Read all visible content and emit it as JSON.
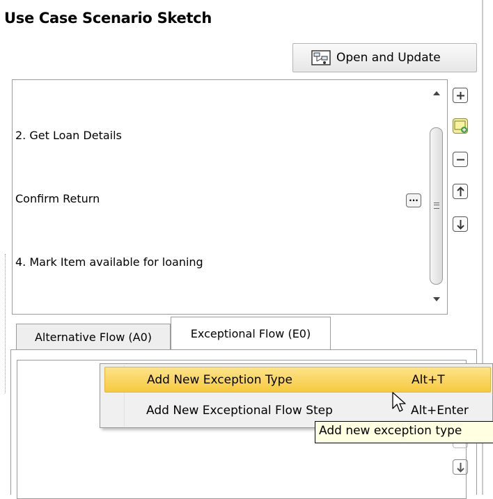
{
  "panel": {
    "title": "Use Case Scenario Sketch",
    "open_update_label": "Open and Update"
  },
  "steps": {
    "items": [
      {
        "label": "2. Get Loan Details"
      },
      {
        "label": "Confirm Return"
      },
      {
        "label": "4. Mark Item available for loaning"
      }
    ],
    "more_label": "..."
  },
  "side_toolbar": {
    "icons": [
      "add-icon",
      "add-note-icon",
      "remove-icon",
      "move-up-icon",
      "move-down-icon"
    ]
  },
  "tabs": [
    {
      "label": "Alternative Flow (A0)",
      "selected": false
    },
    {
      "label": "Exceptional Flow (E0)",
      "selected": true
    }
  ],
  "context_menu": {
    "items": [
      {
        "label": "Add New Exception Type",
        "shortcut": "Alt+T",
        "highlighted": true
      },
      {
        "label": "Add New Exceptional Flow Step",
        "shortcut": "Alt+Enter",
        "highlighted": false
      }
    ]
  },
  "tooltip": {
    "text": "Add new exception type"
  },
  "colors": {
    "highlight": "#f6c93e",
    "tooltip_bg": "#ffffe1",
    "menu_bg": "#f0f0f0"
  }
}
